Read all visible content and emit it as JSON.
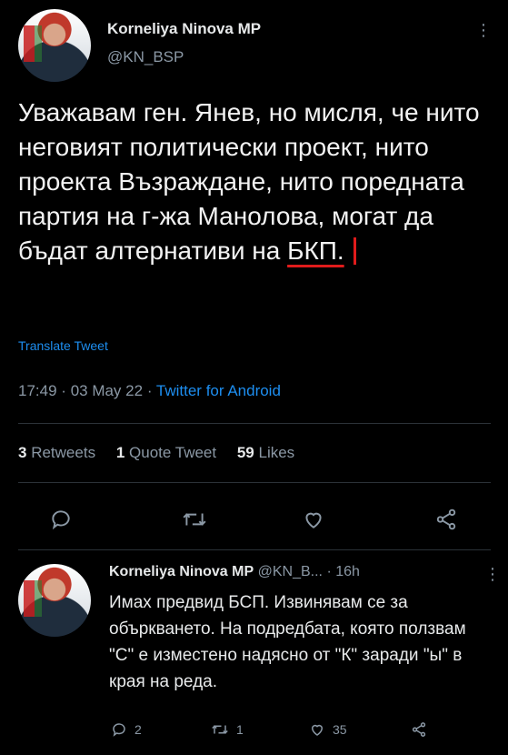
{
  "main_tweet": {
    "author_name": "Korneliya Ninova MP",
    "handle": "@KN_BSP",
    "text_before": "Уважавам ген. Янев, но мисля, че нито неговият политически проект, нито проекта Възраждане, нито поредната партия на г-жа Манолова, могат да бъдат алтернативи на ",
    "text_highlight": "БКП.",
    "translate_label": "Translate Tweet",
    "time": "17:49",
    "date": "03 May 22",
    "source": "Twitter for Android",
    "sep": "·",
    "stats": {
      "retweets_count": "3",
      "retweets_label": "Retweets",
      "quotes_count": "1",
      "quotes_label": "Quote Tweet",
      "likes_count": "59",
      "likes_label": "Likes"
    },
    "actions": [
      "reply-icon",
      "retweet-icon",
      "like-icon",
      "share-icon"
    ]
  },
  "reply_tweet": {
    "author_name": "Korneliya Ninova MP",
    "handle": "@KN_B...",
    "age": "· 16h",
    "text": "Имах предвид БСП. Извинявам се за объркването. На подредбата, която ползвам \"С\" е изместено надясно от \"К\" заради \"ы\" в края на реда.",
    "reply_count": "2",
    "retweet_count": "1",
    "like_count": "35"
  },
  "colors": {
    "accent": "#1d8ef0",
    "annotation": "#e01b1b",
    "muted": "#8b98a5"
  }
}
